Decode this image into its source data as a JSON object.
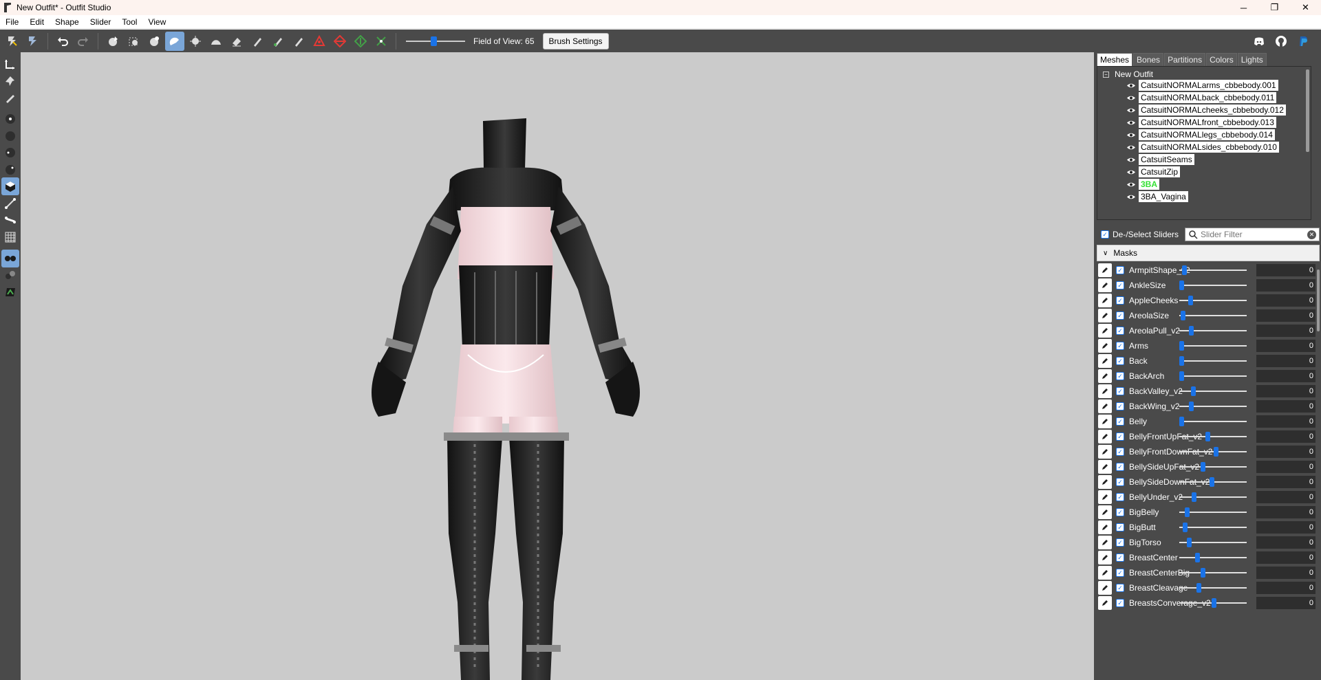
{
  "window": {
    "title": "New Outfit* - Outfit Studio",
    "minimize": "─",
    "maximize": "❐",
    "close": "✕"
  },
  "menu": [
    "File",
    "Edit",
    "Shape",
    "Slider",
    "Tool",
    "View"
  ],
  "toolbar": {
    "fov_label": "Field of View: 65",
    "fov_value": 65,
    "brush_settings_label": "Brush Settings"
  },
  "tabs": [
    "Meshes",
    "Bones",
    "Partitions",
    "Colors",
    "Lights"
  ],
  "tree": {
    "root": "New Outfit",
    "collapse_glyph": "−",
    "meshes": [
      {
        "name": "CatsuitNORMALarms_cbbebody.001",
        "highlight": false
      },
      {
        "name": "CatsuitNORMALback_cbbebody.011",
        "highlight": false
      },
      {
        "name": "CatsuitNORMALcheeks_cbbebody.012",
        "highlight": false
      },
      {
        "name": "CatsuitNORMALfront_cbbebody.013",
        "highlight": false
      },
      {
        "name": "CatsuitNORMALlegs_cbbebody.014",
        "highlight": false
      },
      {
        "name": "CatsuitNORMALsides_cbbebody.010",
        "highlight": false
      },
      {
        "name": "CatsuitSeams",
        "highlight": false
      },
      {
        "name": "CatsuitZip",
        "highlight": false
      },
      {
        "name": "3BA",
        "highlight": true
      },
      {
        "name": "3BA_Vagina",
        "highlight": false
      }
    ]
  },
  "sliders_panel": {
    "deselect_label": "De-/Select Sliders",
    "filter_placeholder": "Slider Filter",
    "masks_label": "Masks",
    "check_glyph": "✓",
    "clear_glyph": "✕",
    "chevron_glyph": "∨"
  },
  "sliders": [
    {
      "name": "ArmpitShape_v2",
      "value": "0",
      "pos": 0.04
    },
    {
      "name": "AnkleSize",
      "value": "0",
      "pos": 0.0
    },
    {
      "name": "AppleCheeks",
      "value": "0",
      "pos": 0.14
    },
    {
      "name": "AreolaSize",
      "value": "0",
      "pos": 0.02
    },
    {
      "name": "AreolaPull_v2",
      "value": "0",
      "pos": 0.16
    },
    {
      "name": "Arms",
      "value": "0",
      "pos": 0.0
    },
    {
      "name": "Back",
      "value": "0",
      "pos": 0.0
    },
    {
      "name": "BackArch",
      "value": "0",
      "pos": 0.0
    },
    {
      "name": "BackValley_v2",
      "value": "0",
      "pos": 0.19
    },
    {
      "name": "BackWing_v2",
      "value": "0",
      "pos": 0.16
    },
    {
      "name": "Belly",
      "value": "0",
      "pos": 0.0
    },
    {
      "name": "BellyFrontUpFat_v2",
      "value": "0",
      "pos": 0.42
    },
    {
      "name": "BellyFrontDownFat_v2",
      "value": "0",
      "pos": 0.55
    },
    {
      "name": "BellySideUpFat_v2",
      "value": "0",
      "pos": 0.35
    },
    {
      "name": "BellySideDownFat_v2",
      "value": "0",
      "pos": 0.49
    },
    {
      "name": "BellyUnder_v2",
      "value": "0",
      "pos": 0.2
    },
    {
      "name": "BigBelly",
      "value": "0",
      "pos": 0.09
    },
    {
      "name": "BigButt",
      "value": "0",
      "pos": 0.06
    },
    {
      "name": "BigTorso",
      "value": "0",
      "pos": 0.12
    },
    {
      "name": "BreastCenter",
      "value": "0",
      "pos": 0.26
    },
    {
      "name": "BreastCenterBig",
      "value": "0",
      "pos": 0.34
    },
    {
      "name": "BreastCleavage",
      "value": "0",
      "pos": 0.28
    },
    {
      "name": "BreastsConverage_v2",
      "value": "0",
      "pos": 0.52
    }
  ]
}
